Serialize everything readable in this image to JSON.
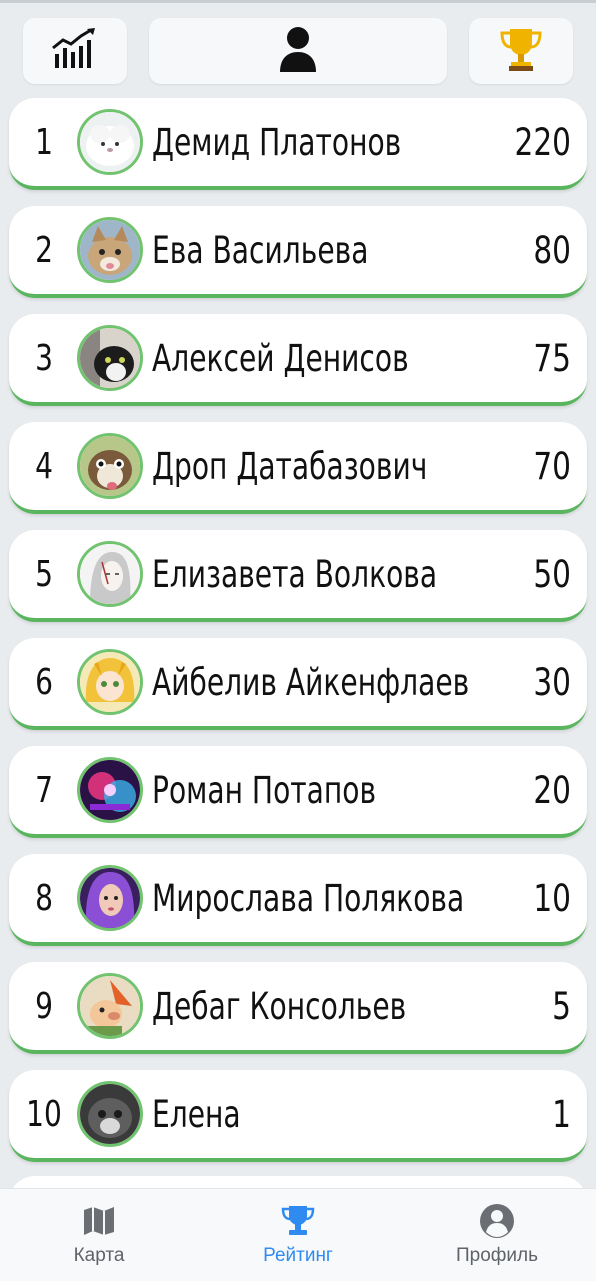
{
  "toolbar": {
    "stats_icon": "bar-chart-trend-icon",
    "center_icon": "person-icon",
    "right_icon": "trophy-icon"
  },
  "leaderboard": [
    {
      "rank": "1",
      "name": "Демид Платонов",
      "score": "220",
      "avatar": "white-fluffy-animal"
    },
    {
      "rank": "2",
      "name": "Ева Васильева",
      "score": "80",
      "avatar": "cat-tabby"
    },
    {
      "rank": "3",
      "name": "Алексей Денисов",
      "score": "75",
      "avatar": "cat-black-white"
    },
    {
      "rank": "4",
      "name": "Дроп Датабазович",
      "score": "70",
      "avatar": "dog-funny"
    },
    {
      "rank": "5",
      "name": "Елизавета Волкова",
      "score": "50",
      "avatar": "sketch-portrait"
    },
    {
      "rank": "6",
      "name": "Айбелив Айкенфлаев",
      "score": "30",
      "avatar": "anime-girl-blonde"
    },
    {
      "rank": "7",
      "name": "Роман Потапов",
      "score": "20",
      "avatar": "neon-cyber-art"
    },
    {
      "rank": "8",
      "name": "Мирослава Полякова",
      "score": "10",
      "avatar": "girl-purple-hair"
    },
    {
      "rank": "9",
      "name": "Дебаг Консольев",
      "score": "5",
      "avatar": "cartoon-character"
    },
    {
      "rank": "10",
      "name": "Елена",
      "score": "1",
      "avatar": "cat-dark-gray"
    }
  ],
  "nav": {
    "map_label": "Карта",
    "rating_label": "Рейтинг",
    "profile_label": "Профиль",
    "active": "rating"
  },
  "colors": {
    "accent_active": "#2f8bf0",
    "row_underline": "#5ab55e",
    "avatar_ring": "#72c36f",
    "trophy": "#f0b400"
  }
}
